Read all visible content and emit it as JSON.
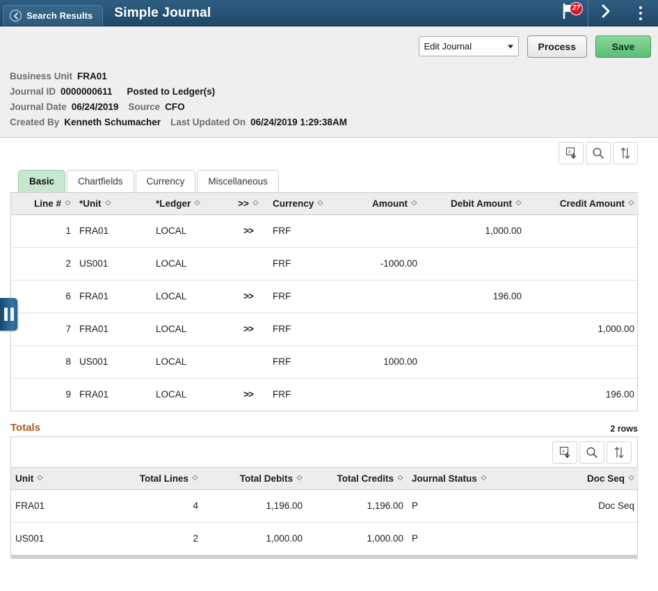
{
  "topbar": {
    "back_label": "Search Results",
    "title": "Simple Journal",
    "notification_count": "27",
    "icons": {
      "back": "chevron-left-icon",
      "flag": "flag-icon",
      "next": "chevron-right-icon",
      "menu": "more-vertical-icon"
    }
  },
  "actionbar": {
    "selected_action": "Edit Journal",
    "action_options": [
      "Edit Journal"
    ],
    "process_label": "Process",
    "save_label": "Save"
  },
  "journal_header": {
    "business_unit_label": "Business Unit",
    "business_unit_value": "FRA01",
    "journal_id_label": "Journal ID",
    "journal_id_value": "0000000611",
    "posted_status": "Posted to Ledger(s)",
    "journal_date_label": "Journal Date",
    "journal_date_value": "06/24/2019",
    "source_label": "Source",
    "source_value": "CFO",
    "created_by_label": "Created By",
    "created_by_value": "Kenneth Schumacher",
    "last_updated_label": "Last Updated On",
    "last_updated_value": "06/24/2019  1:29:38AM"
  },
  "grid_toolbar": {
    "excel_icon": "download-excel-icon",
    "search_icon": "search-icon",
    "sort_icon": "sort-updown-icon"
  },
  "tabs": [
    {
      "label": "Basic",
      "active": true
    },
    {
      "label": "Chartfields",
      "active": false
    },
    {
      "label": "Currency",
      "active": false
    },
    {
      "label": "Miscellaneous",
      "active": false
    }
  ],
  "lines_grid": {
    "columns": [
      "Line #",
      "*Unit",
      "*Ledger",
      ">>",
      "Currency",
      "Amount",
      "Debit Amount",
      "Credit Amount"
    ],
    "rows": [
      {
        "line": "1",
        "unit": "FRA01",
        "ledger": "LOCAL",
        "expand": ">>",
        "currency": "FRF",
        "amount": "",
        "debit": "1,000.00",
        "credit": ""
      },
      {
        "line": "2",
        "unit": "US001",
        "ledger": "LOCAL",
        "expand": "",
        "currency": "FRF",
        "amount": "-1000.00",
        "debit": "",
        "credit": ""
      },
      {
        "line": "6",
        "unit": "FRA01",
        "ledger": "LOCAL",
        "expand": ">>",
        "currency": "FRF",
        "amount": "",
        "debit": "196.00",
        "credit": ""
      },
      {
        "line": "7",
        "unit": "FRA01",
        "ledger": "LOCAL",
        "expand": ">>",
        "currency": "FRF",
        "amount": "",
        "debit": "",
        "credit": "1,000.00"
      },
      {
        "line": "8",
        "unit": "US001",
        "ledger": "LOCAL",
        "expand": "",
        "currency": "FRF",
        "amount": "1000.00",
        "debit": "",
        "credit": ""
      },
      {
        "line": "9",
        "unit": "FRA01",
        "ledger": "LOCAL",
        "expand": ">>",
        "currency": "FRF",
        "amount": "",
        "debit": "",
        "credit": "196.00"
      }
    ]
  },
  "side_handle": {
    "icon": "collapse-panel-handle-icon"
  },
  "totals": {
    "title": "Totals",
    "rows_count": "2 rows",
    "columns": [
      "Unit",
      "Total Lines",
      "Total Debits",
      "Total Credits",
      "Journal Status",
      "Doc Seq"
    ],
    "rows": [
      {
        "unit": "FRA01",
        "total_lines": "4",
        "total_debits": "1,196.00",
        "total_credits": "1,196.00",
        "status": "P",
        "doc_seq": "Doc Seq"
      },
      {
        "unit": "US001",
        "total_lines": "2",
        "total_debits": "1,000.00",
        "total_credits": "1,000.00",
        "status": "P",
        "doc_seq": ""
      }
    ]
  },
  "colors": {
    "topbar": "#275375",
    "accent_green": "#5bbd74",
    "tab_active": "#c9e7cf",
    "link": "#3366bb",
    "totals_title": "#b0581c",
    "badge_red": "#d8172a"
  }
}
